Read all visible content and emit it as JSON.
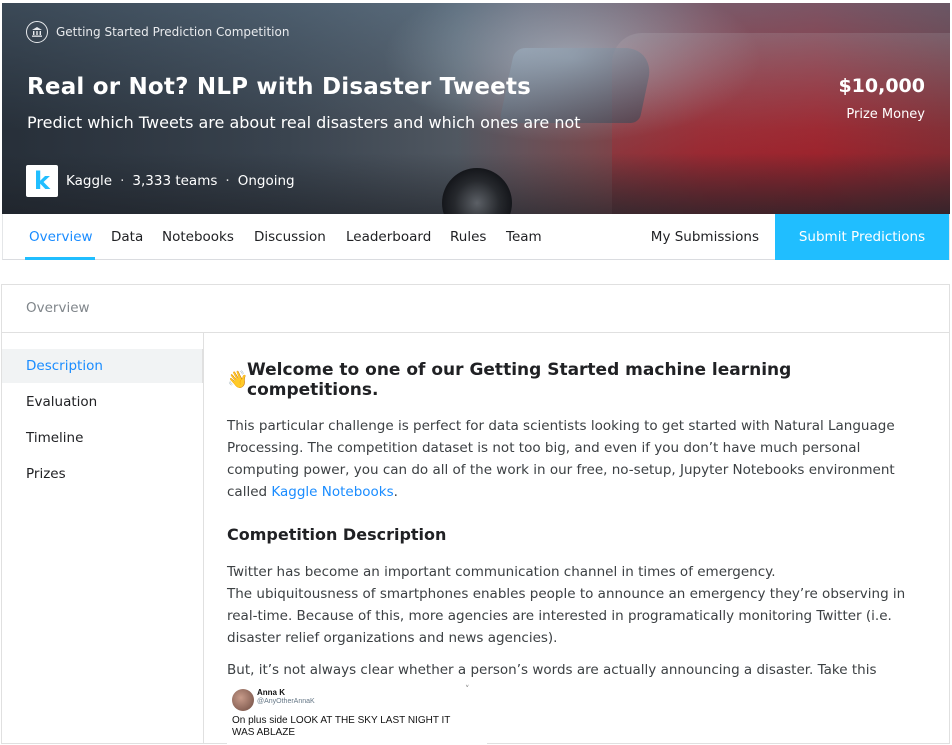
{
  "header": {
    "competition_type": "Getting Started Prediction Competition",
    "title": "Real or Not? NLP with Disaster Tweets",
    "subtitle": "Predict which Tweets are about real disasters and which ones are not",
    "prize_amount": "$10,000",
    "prize_label": "Prize Money",
    "host_logo_letter": "k",
    "host": "Kaggle",
    "teams": "3,333 teams",
    "status": "Ongoing",
    "separator": "·"
  },
  "tabs": {
    "items": [
      "Overview",
      "Data",
      "Notebooks",
      "Discussion",
      "Leaderboard",
      "Rules",
      "Team"
    ],
    "active": "Overview",
    "my_submissions": "My Submissions",
    "submit_button": "Submit Predictions"
  },
  "overview": {
    "card_title": "Overview",
    "sidebar": [
      "Description",
      "Evaluation",
      "Timeline",
      "Prizes"
    ],
    "sidebar_active": "Description"
  },
  "content": {
    "welcome_emoji": "👋",
    "welcome_heading": "Welcome to one of our Getting Started machine learning competitions.",
    "intro_text": "This particular challenge is perfect for data scientists looking to get started with Natural Language Processing. The competition dataset is not too big, and even if you don’t have much personal computing power, you can do all of the work in our free, no-setup, Jupyter Notebooks environment called ",
    "intro_link": "Kaggle Notebooks",
    "intro_end": ".",
    "section_heading": "Competition Description",
    "desc_line1": "Twitter has become an important communication channel in times of emergency.",
    "desc_line2": "The ubiquitousness of smartphones enables people to announce an emergency they’re observing in real-time. Because of this, more agencies are interested in programatically monitoring Twitter (i.e. disaster relief organizations and news agencies).",
    "desc_line3": "But, it’s not always clear whether a person’s words are actually announcing a disaster. Take this example:"
  },
  "tweet": {
    "name": "Anna K",
    "handle": "@AnyOtherAnnaK",
    "chevron": "˅",
    "text": "On plus side LOOK AT THE SKY LAST NIGHT IT WAS ABLAZE"
  },
  "colors": {
    "accent": "#20beff",
    "link": "#1a8cff",
    "text": "#3c4043"
  }
}
